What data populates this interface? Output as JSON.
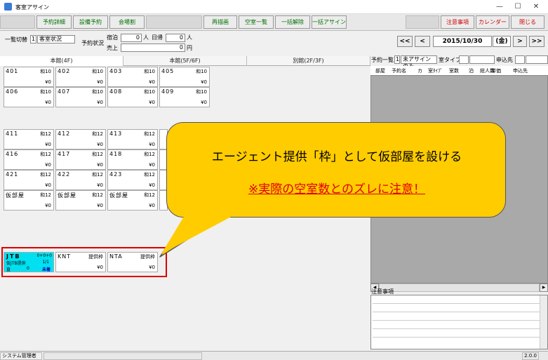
{
  "window": {
    "title": "客室アサイン",
    "min": "—",
    "max": "☐",
    "close": "✕"
  },
  "toolbar": {
    "left": [
      "予約詳細",
      "設備予約",
      "会場割"
    ],
    "mid": [
      "再描画",
      "空室一覧",
      "一括解除",
      "一括アサイン"
    ],
    "right": [
      "注意事項",
      "カレンダー",
      "閉じる"
    ]
  },
  "filters": {
    "list_switch_label": "一覧切替",
    "list_switch_num": "1",
    "list_switch_val": "客室状況",
    "reserve_status_label": "予約状況",
    "stay_label": "宿泊",
    "stay_val": "0",
    "person_label": "人",
    "daytrip_label": "日帰",
    "daytrip_val": "0",
    "person_label2": "人",
    "sales_label": "売上",
    "sales_val": "0",
    "yen_label": "円"
  },
  "datenav": {
    "first": "<<",
    "prev": "<",
    "date": "2015/10/30",
    "weekday": "(金)",
    "next": ">",
    "last": ">>"
  },
  "tabs": [
    "本館(4F)",
    "本館(5F/6F)",
    "別館(2F/3F)"
  ],
  "rooms": [
    {
      "no": "401",
      "type": "和10",
      "price": "¥0"
    },
    {
      "no": "402",
      "type": "和10",
      "price": "¥0"
    },
    {
      "no": "403",
      "type": "和10",
      "price": "¥0"
    },
    {
      "no": "405",
      "type": "和10",
      "price": "¥0"
    },
    {
      "no": "406",
      "type": "和10",
      "price": "¥0"
    },
    {
      "no": "407",
      "type": "和10",
      "price": "¥0"
    },
    {
      "no": "408",
      "type": "和10",
      "price": "¥0"
    },
    {
      "no": "409",
      "type": "和10",
      "price": "¥0"
    },
    {
      "no": "411",
      "type": "和12",
      "price": "¥0"
    },
    {
      "no": "412",
      "type": "和12",
      "price": "¥0"
    },
    {
      "no": "413",
      "type": "和12",
      "price": "¥0"
    },
    {
      "no": "416",
      "type": "和12",
      "price": "¥0"
    },
    {
      "no": "417",
      "type": "和12",
      "price": "¥0"
    },
    {
      "no": "418",
      "type": "和12",
      "price": "¥0"
    },
    {
      "no": "421",
      "type": "和12",
      "price": "¥0"
    },
    {
      "no": "422",
      "type": "和12",
      "price": "¥0"
    },
    {
      "no": "423",
      "type": "和12",
      "price": "¥0"
    },
    {
      "no": "仮部屋",
      "type": "和12",
      "price": "¥0"
    },
    {
      "no": "仮部屋",
      "type": "和12",
      "price": "¥0"
    },
    {
      "no": "仮部屋",
      "type": "和12",
      "price": "¥0"
    }
  ],
  "agents": [
    {
      "name": "JTB",
      "line1r": "0+0+0",
      "line2": "仮JTB提供",
      "line2r": "1/1",
      "line3": "直",
      "line3m": "0",
      "line3r": "未着"
    },
    {
      "name": "KNT",
      "tag": "提供枠",
      "price": "¥0"
    },
    {
      "name": "NTA",
      "tag": "提供枠",
      "price": "¥0"
    }
  ],
  "right": {
    "list_label": "予約一覧",
    "list_num": "1",
    "list_val": "未アサインのみ",
    "roomtype_label": "室タイプ",
    "applicant_label": "申込先",
    "columns": [
      "部屋",
      "予約名",
      "カ",
      "室ﾀｲﾌﾟ",
      "室数",
      "泊",
      "総人数",
      "単価",
      "申込先"
    ],
    "notes_label": "注意事項"
  },
  "callout": {
    "line1": "エージェント提供「枠」として仮部屋を設ける",
    "line2": "※実際の空室数とのズレに注意！"
  },
  "status": {
    "user": "システム管理者",
    "version": "2.0.0"
  },
  "colors": {
    "accent_green": "#007000",
    "accent_red": "#d00000",
    "callout": "#ffcc00",
    "jtb_cyan": "#00e0f0",
    "highlight_border": "#e00000"
  }
}
